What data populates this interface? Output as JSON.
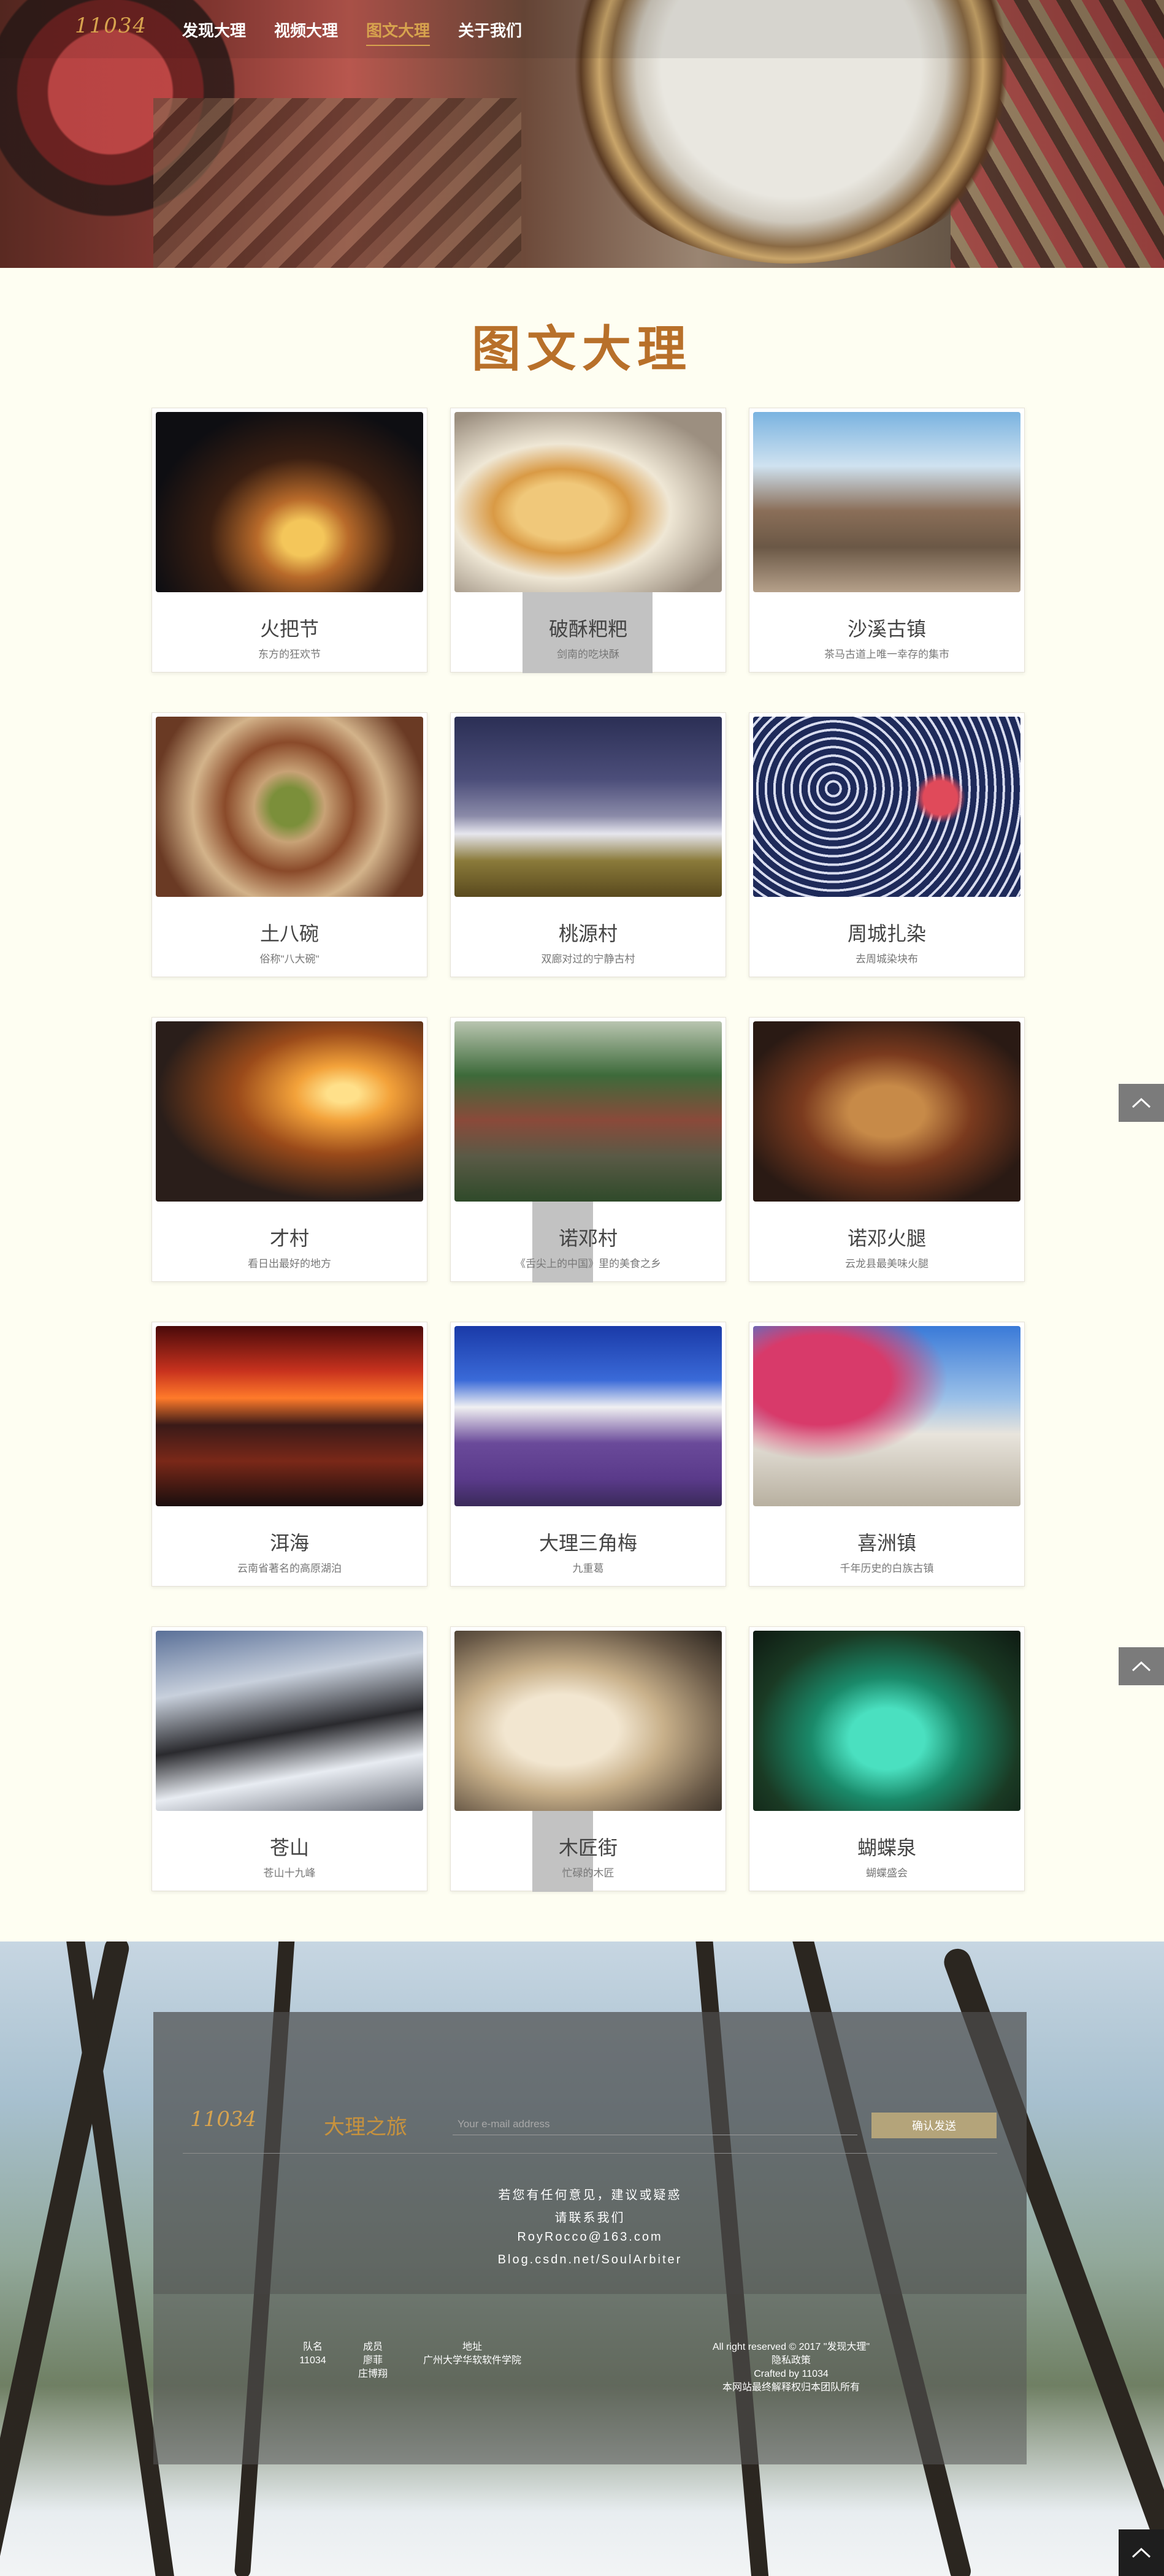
{
  "brand": {
    "logo": "11034"
  },
  "nav": {
    "items": [
      {
        "label": "发现大理",
        "active": false
      },
      {
        "label": "视频大理",
        "active": false
      },
      {
        "label": "图文大理",
        "active": true
      },
      {
        "label": "关于我们",
        "active": false
      }
    ]
  },
  "main": {
    "title": "图文大理",
    "cards": [
      {
        "title": "火把节",
        "subtitle": "东方的狂欢节"
      },
      {
        "title": "破酥粑粑",
        "subtitle": "剑南的吃块酥"
      },
      {
        "title": "沙溪古镇",
        "subtitle": "茶马古道上唯一幸存的集市"
      },
      {
        "title": "土八碗",
        "subtitle": "俗称\"八大碗\""
      },
      {
        "title": "桃源村",
        "subtitle": "双廊对过的宁静古村"
      },
      {
        "title": "周城扎染",
        "subtitle": "去周城染块布"
      },
      {
        "title": "才村",
        "subtitle": "看日出最好的地方"
      },
      {
        "title": "诺邓村",
        "subtitle": "《舌尖上的中国》里的美食之乡"
      },
      {
        "title": "诺邓火腿",
        "subtitle": "云龙县最美味火腿"
      },
      {
        "title": "洱海",
        "subtitle": "云南省著名的高原湖泊"
      },
      {
        "title": "大理三角梅",
        "subtitle": "九重葛"
      },
      {
        "title": "喜洲镇",
        "subtitle": "千年历史的白族古镇"
      },
      {
        "title": "苍山",
        "subtitle": "苍山十九峰"
      },
      {
        "title": "木匠街",
        "subtitle": "忙碌的木匠"
      },
      {
        "title": "蝴蝶泉",
        "subtitle": "蝴蝶盛会"
      }
    ]
  },
  "back_to_top": {
    "icon": "chevron-up-icon"
  },
  "footer": {
    "logo": "11034",
    "tagline": "大理之旅",
    "email_placeholder": "Your e-mail address",
    "email_value": "",
    "send_label": "确认发送",
    "contact": {
      "line1": "若您有任何意见，建议或疑惑",
      "line2": "请联系我们",
      "email": "RoyRocco@163.com",
      "blog": "Blog.csdn.net/SoulArbiter"
    },
    "team": {
      "name_label": "队名",
      "name_value": "11034",
      "members_label": "成员",
      "members": [
        "廖菲",
        "庄博翔"
      ],
      "address_label": "地址",
      "address_value": "广州大学华软软件学院"
    },
    "legal": {
      "rights": "All right reserved © 2017 \"发现大理\"",
      "privacy": "隐私政策",
      "crafted": "Crafted by 11034",
      "ownership": "本网站最终解释权归本团队所有"
    }
  }
}
